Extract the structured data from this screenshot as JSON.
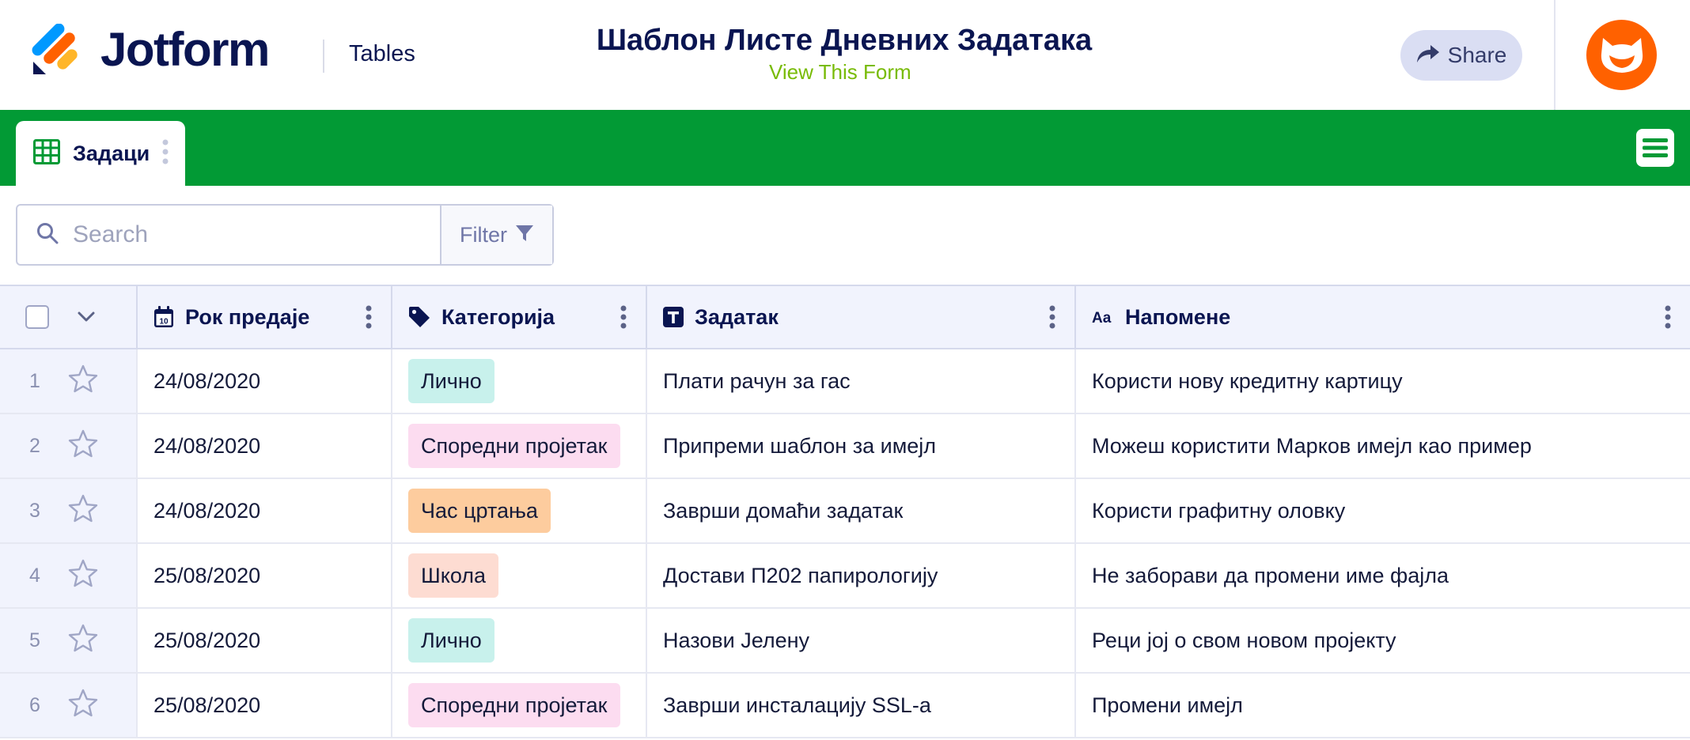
{
  "header": {
    "brand": "Jotform",
    "product": "Tables",
    "form_title": "Шаблон Листе Дневних Задатака",
    "view_form_link": "View This Form",
    "share_label": "Share"
  },
  "tabs": [
    {
      "label": "Задаци",
      "icon": "table-grid-icon",
      "active": true
    }
  ],
  "search": {
    "placeholder": "Search",
    "value": ""
  },
  "filter": {
    "label": "Filter"
  },
  "columns": [
    {
      "label": "Рок предаје",
      "icon": "calendar-icon"
    },
    {
      "label": "Категорија",
      "icon": "tag-icon"
    },
    {
      "label": "Задатак",
      "icon": "text-t-icon"
    },
    {
      "label": "Напомене",
      "icon": "aa-text-icon"
    }
  ],
  "category_colors": {
    "Лично": "#c8f1ec",
    "Споредни пројетак": "#fcdcf0",
    "Час цртања": "#fdcc9e",
    "Школа": "#fddcd2"
  },
  "rows": [
    {
      "num": "1",
      "due": "24/08/2020",
      "category": "Лично",
      "task": "Плати рачун за гас",
      "notes": "Користи нову кредитну картицу"
    },
    {
      "num": "2",
      "due": "24/08/2020",
      "category": "Споредни пројетак",
      "task": "Припреми шаблон за имејл",
      "notes": "Можеш користити Марков имејл као пример"
    },
    {
      "num": "3",
      "due": "24/08/2020",
      "category": "Час цртања",
      "task": "Заврши домаћи задатак",
      "notes": "Користи графитну оловку"
    },
    {
      "num": "4",
      "due": "25/08/2020",
      "category": "Школа",
      "task": "Достави П202 папирологију",
      "notes": "Не заборави да промени име фајла"
    },
    {
      "num": "5",
      "due": "25/08/2020",
      "category": "Лично",
      "task": "Назови Јелену",
      "notes": "Реци јој о свом новом пројекту"
    },
    {
      "num": "6",
      "due": "25/08/2020",
      "category": "Споредни пројетак",
      "task": "Заврши инсталацију SSL-а",
      "notes": "Промени имејл"
    }
  ],
  "colors": {
    "tabbar": "#029a35",
    "brand_text": "#0a1551",
    "link": "#78bb07",
    "avatar": "#ff6100"
  }
}
